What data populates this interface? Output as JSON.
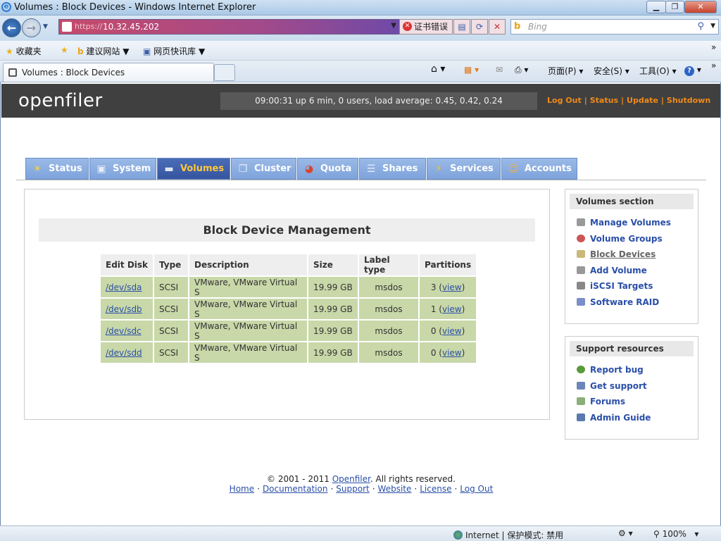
{
  "window": {
    "title": "Volumes : Block Devices - Windows Internet Explorer",
    "min_glyph": "▁",
    "max_glyph": "❐",
    "close_glyph": "✕"
  },
  "address_bar": {
    "protocol": "https://",
    "host": "10.32.45.202",
    "cert_error": "证书错误",
    "search_placeholder": "Bing"
  },
  "favorites_bar": {
    "favorites": "收藏夹",
    "suggested_sites": "建议网站",
    "web_slices": "网页快讯库",
    "chevron": "»"
  },
  "browser_tab": {
    "label": "Volumes : Block Devices"
  },
  "command_bar": {
    "page": "页面(P)",
    "safety": "安全(S)",
    "tools": "工具(O)",
    "help": "?"
  },
  "header": {
    "logo": "openfiler",
    "uptime": "09:00:31 up 6 min, 0 users, load average: 0.45, 0.42, 0.24",
    "links": [
      "Log Out",
      "Status",
      "Update",
      "Shutdown"
    ]
  },
  "nav_tabs": [
    {
      "label": "Status",
      "icon": "sun-icon",
      "active": false
    },
    {
      "label": "System",
      "icon": "monitor-icon",
      "active": false
    },
    {
      "label": "Volumes",
      "icon": "disk-icon",
      "active": true
    },
    {
      "label": "Cluster",
      "icon": "cluster-icon",
      "active": false
    },
    {
      "label": "Quota",
      "icon": "pie-icon",
      "active": false
    },
    {
      "label": "Shares",
      "icon": "server-icon",
      "active": false
    },
    {
      "label": "Services",
      "icon": "lightning-icon",
      "active": false
    },
    {
      "label": "Accounts",
      "icon": "users-icon",
      "active": false
    }
  ],
  "main": {
    "title": "Block Device Management",
    "columns": [
      "Edit Disk",
      "Type",
      "Description",
      "Size",
      "Label type",
      "Partitions"
    ],
    "rows": [
      {
        "disk": "/dev/sda",
        "type": "SCSI",
        "description": "VMware, VMware Virtual S",
        "size": "19.99 GB",
        "label": "msdos",
        "partitions": "3",
        "view": "view"
      },
      {
        "disk": "/dev/sdb",
        "type": "SCSI",
        "description": "VMware, VMware Virtual S",
        "size": "19.99 GB",
        "label": "msdos",
        "partitions": "1",
        "view": "view"
      },
      {
        "disk": "/dev/sdc",
        "type": "SCSI",
        "description": "VMware, VMware Virtual S",
        "size": "19.99 GB",
        "label": "msdos",
        "partitions": "0",
        "view": "view"
      },
      {
        "disk": "/dev/sdd",
        "type": "SCSI",
        "description": "VMware, VMware Virtual S",
        "size": "19.99 GB",
        "label": "msdos",
        "partitions": "0",
        "view": "view"
      }
    ]
  },
  "volumes_section": {
    "heading": "Volumes section",
    "items": [
      {
        "label": "Manage Volumes",
        "icon": "disk-icon",
        "current": false
      },
      {
        "label": "Volume Groups",
        "icon": "volume-group-icon",
        "current": false
      },
      {
        "label": "Block Devices",
        "icon": "block-device-icon",
        "current": true
      },
      {
        "label": "Add Volume",
        "icon": "add-disk-icon",
        "current": false
      },
      {
        "label": "iSCSI Targets",
        "icon": "iscsi-icon",
        "current": false
      },
      {
        "label": "Software RAID",
        "icon": "raid-icon",
        "current": false
      }
    ]
  },
  "support_resources": {
    "heading": "Support resources",
    "items": [
      {
        "label": "Report bug",
        "icon": "bug-icon"
      },
      {
        "label": "Get support",
        "icon": "support-icon"
      },
      {
        "label": "Forums",
        "icon": "forum-icon"
      },
      {
        "label": "Admin Guide",
        "icon": "book-icon"
      }
    ]
  },
  "footer": {
    "copyright_prefix": "© 2001 - 2011 ",
    "copyright_link": "Openfiler",
    "copyright_suffix": ". All rights reserved.",
    "links": [
      "Home",
      "Documentation",
      "Support",
      "Website",
      "License",
      "Log Out"
    ]
  },
  "status_bar": {
    "zone": "Internet | 保护模式: 禁用",
    "zoom": "100%"
  },
  "colors": {
    "header_bg": "#404040",
    "link_orange": "#f08a1a",
    "tab_blue": "#7ea3dc",
    "row_green": "#c8d8a8",
    "link_blue": "#2a4fa8"
  }
}
